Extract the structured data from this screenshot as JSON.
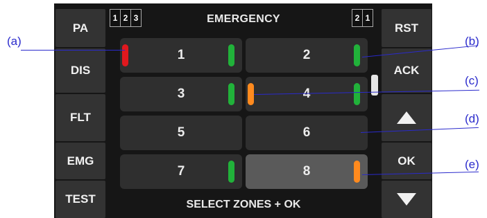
{
  "colors": {
    "red": "#e0181e",
    "green": "#21b23a",
    "orange": "#ff8a1e",
    "callout": "#2a2acc"
  },
  "header": {
    "title": "EMERGENCY",
    "left_digits": [
      "1",
      "2",
      "3"
    ],
    "right_digits": [
      "2",
      "1"
    ]
  },
  "left_buttons": [
    "PA",
    "DIS",
    "FLT",
    "EMG",
    "TEST"
  ],
  "right_buttons": {
    "rst": "RST",
    "ack": "ACK",
    "up_icon": "up-triangle-icon",
    "ok": "OK",
    "down_icon": "down-triangle-icon"
  },
  "zones": [
    {
      "label": "1",
      "left_indicator": "red",
      "right_indicator": "green",
      "selected": false
    },
    {
      "label": "2",
      "left_indicator": "",
      "right_indicator": "green",
      "selected": false
    },
    {
      "label": "3",
      "left_indicator": "",
      "right_indicator": "green",
      "selected": false
    },
    {
      "label": "4",
      "left_indicator": "orange",
      "right_indicator": "green",
      "selected": false
    },
    {
      "label": "5",
      "left_indicator": "",
      "right_indicator": "",
      "selected": false
    },
    {
      "label": "6",
      "left_indicator": "",
      "right_indicator": "",
      "selected": false
    },
    {
      "label": "7",
      "left_indicator": "",
      "right_indicator": "green",
      "selected": false
    },
    {
      "label": "8",
      "left_indicator": "",
      "right_indicator": "orange",
      "selected": true
    }
  ],
  "footer": "SELECT ZONES + OK",
  "callouts": {
    "a": "(a)",
    "b": "(b)",
    "c": "(c)",
    "d": "(d)",
    "e": "(e)"
  }
}
